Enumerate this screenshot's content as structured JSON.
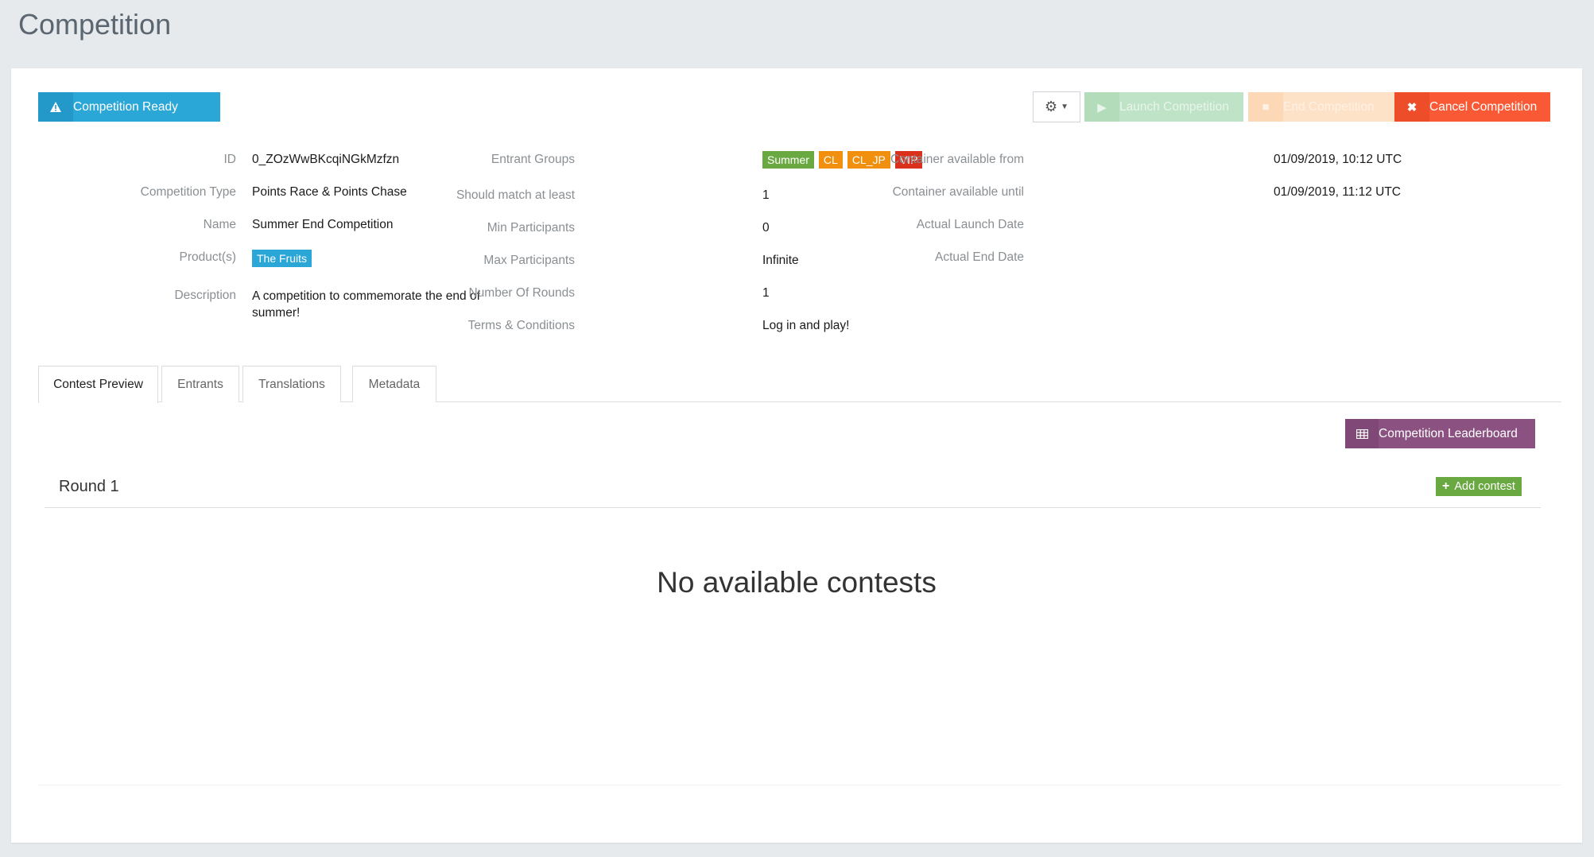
{
  "page": {
    "title": "Competition"
  },
  "toolbar": {
    "status_label": "Competition Ready",
    "status_icon": "warning-icon",
    "settings_icon": "gear-icon",
    "launch_label": "Launch Competition",
    "end_label": "End Competition",
    "cancel_label": "Cancel Competition"
  },
  "details": {
    "id": {
      "label": "ID",
      "value": "0_ZOzWwBKcqiNGkMzfzn"
    },
    "competition_type": {
      "label": "Competition Type",
      "value": "Points Race & Points Chase"
    },
    "name": {
      "label": "Name",
      "value": "Summer End Competition"
    },
    "products": {
      "label": "Product(s)",
      "tags": [
        "The Fruits"
      ]
    },
    "description": {
      "label": "Description",
      "value": "A competition to commemorate the end of summer!"
    },
    "entrant_groups": {
      "label": "Entrant Groups",
      "tags": [
        {
          "text": "Summer",
          "color": "#6aa842"
        },
        {
          "text": "CL",
          "color": "#f0900e"
        },
        {
          "text": "CL_JP",
          "color": "#f0900e"
        },
        {
          "text": "VIP",
          "color": "#d9311c"
        }
      ]
    },
    "should_match": {
      "label": "Should match at least",
      "value": "1"
    },
    "min_participants": {
      "label": "Min Participants",
      "value": "0"
    },
    "max_participants": {
      "label": "Max Participants",
      "value": "Infinite"
    },
    "number_of_rounds": {
      "label": "Number Of Rounds",
      "value": "1"
    },
    "terms": {
      "label": "Terms & Conditions",
      "value": "Log in and play!"
    },
    "container_from": {
      "label": "Container available from",
      "value": "01/09/2019, 10:12 UTC"
    },
    "container_until": {
      "label": "Container available until",
      "value": "01/09/2019, 11:12 UTC"
    },
    "actual_launch": {
      "label": "Actual Launch Date",
      "value": ""
    },
    "actual_end": {
      "label": "Actual End Date",
      "value": ""
    }
  },
  "tabs": [
    {
      "label": "Contest Preview",
      "active": true
    },
    {
      "label": "Entrants",
      "active": false
    },
    {
      "label": "Translations",
      "active": false
    },
    {
      "label": "Metadata",
      "active": false
    }
  ],
  "preview": {
    "leaderboard_label": "Competition Leaderboard",
    "round_title": "Round 1",
    "add_contest_label": "Add contest",
    "empty_message": "No available contests"
  },
  "colors": {
    "primary": "#2aa6d7",
    "danger": "#f95a35",
    "success": "#6aa842",
    "purple": "#8a5181"
  }
}
